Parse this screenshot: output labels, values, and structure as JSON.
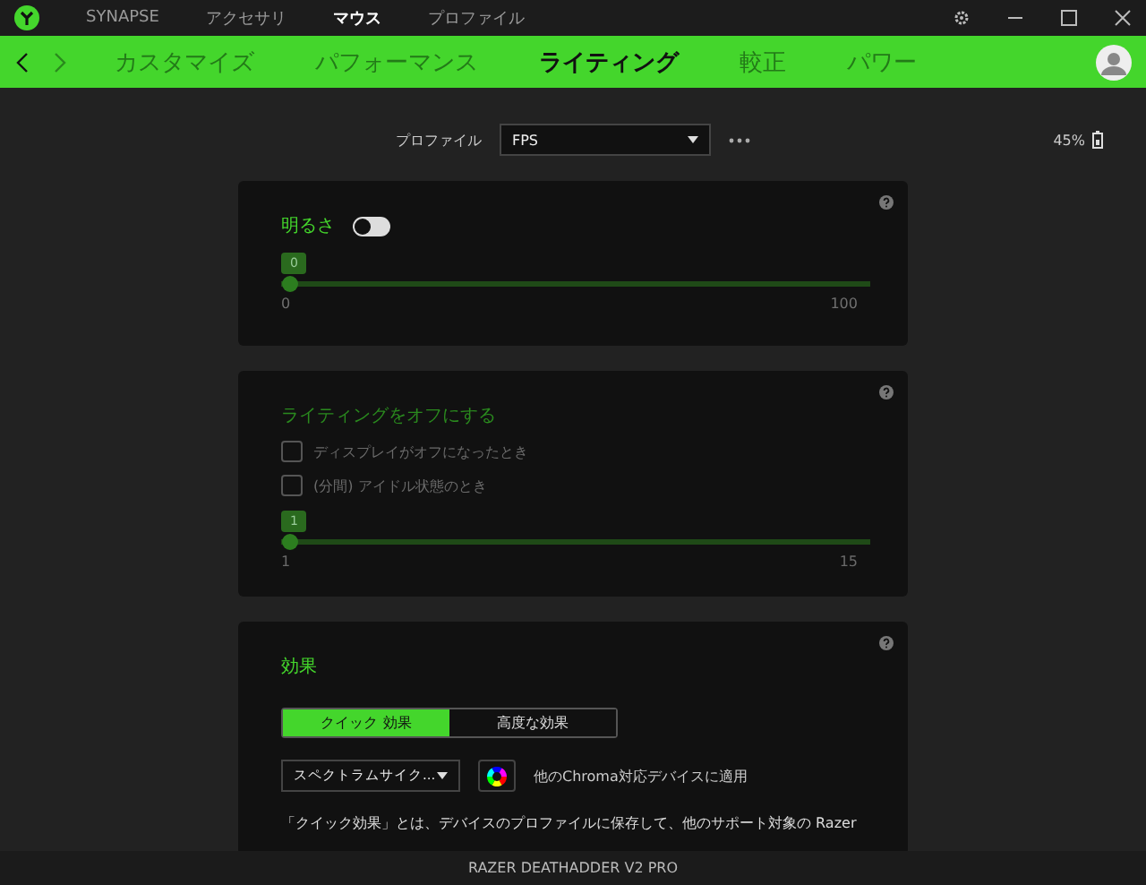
{
  "top_tabs": [
    {
      "label": "SYNAPSE",
      "selected": false
    },
    {
      "label": "アクセサリ",
      "selected": false
    },
    {
      "label": "マウス",
      "selected": true
    },
    {
      "label": "プロファイル",
      "selected": false
    }
  ],
  "nav_tabs": [
    {
      "label": "カスタマイズ",
      "selected": false
    },
    {
      "label": "パフォーマンス",
      "selected": false
    },
    {
      "label": "ライティング",
      "selected": true
    },
    {
      "label": "較正",
      "selected": false
    },
    {
      "label": "パワー",
      "selected": false
    }
  ],
  "profile": {
    "label": "プロファイル",
    "value": "FPS"
  },
  "battery": {
    "reading": "45%"
  },
  "brightness": {
    "title": "明るさ",
    "on": false,
    "value": "0",
    "level": 0,
    "min": "0",
    "max": "100"
  },
  "lighting_off": {
    "title": "ライティングをオフにする",
    "disabled": true,
    "options": [
      {
        "label": "ディスプレイがオフになったとき",
        "checked": false
      },
      {
        "label": "(分間) アイドル状態のとき",
        "checked": false
      }
    ],
    "value": "1",
    "level": 0,
    "min": "1",
    "max": "15"
  },
  "effects": {
    "title": "効果",
    "modes": [
      {
        "label": "クイック 効果",
        "selected": true
      },
      {
        "label": "高度な効果",
        "selected": false
      }
    ],
    "effect": "スペクトラムサイク...",
    "apply_label": "他のChroma対応デバイスに適用",
    "description": "「クイック効果」とは、デバイスのプロファイルに保存して、他のサポート対象の Razer"
  },
  "footer": "RAZER DEATHADDER V2 PRO"
}
